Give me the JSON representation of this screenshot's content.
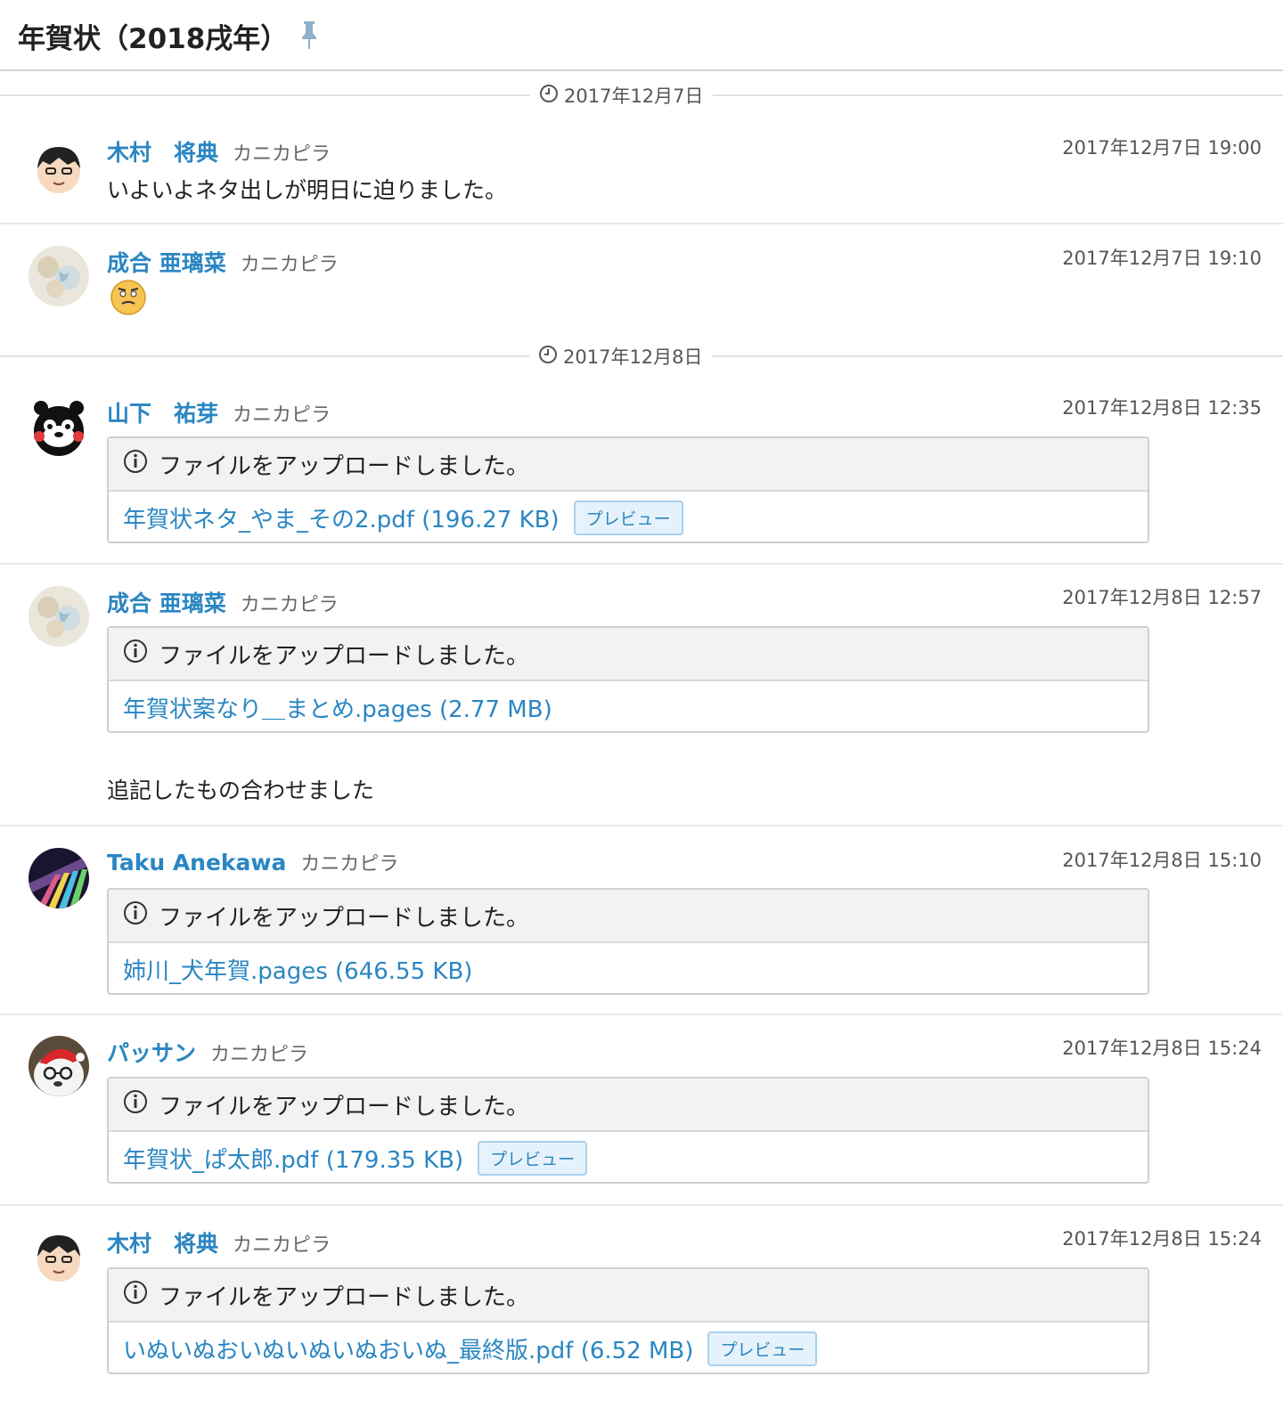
{
  "header": {
    "title": "年賀状（2018戌年）"
  },
  "date_separators": [
    "2017年12月7日",
    "2017年12月8日"
  ],
  "common": {
    "upload_notice": "ファイルをアップロードしました。",
    "preview_label": "プレビュー"
  },
  "messages": [
    {
      "author": "木村　将典",
      "team": "カニカピラ",
      "timestamp": "2017年12月7日 19:00",
      "text": "いよいよネタ出しが明日に迫りました。"
    },
    {
      "author": "成合 亜璃菜",
      "team": "カニカピラ",
      "timestamp": "2017年12月7日 19:10"
    },
    {
      "author": "山下　祐芽",
      "team": "カニカピラ",
      "timestamp": "2017年12月8日 12:35",
      "file": "年賀状ネタ_やま_その2.pdf (196.27 KB)"
    },
    {
      "author": "成合 亜璃菜",
      "team": "カニカピラ",
      "timestamp": "2017年12月8日 12:57",
      "file": "年賀状案なり＿まとめ.pages (2.77 MB)",
      "text": "追記したもの合わせました"
    },
    {
      "author": "Taku Anekawa",
      "team": "カニカピラ",
      "timestamp": "2017年12月8日 15:10",
      "file": "姉川_犬年賀.pages (646.55 KB)"
    },
    {
      "author": "パッサン",
      "team": "カニカピラ",
      "timestamp": "2017年12月8日 15:24",
      "file": "年賀状_ぱ太郎.pdf (179.35 KB)"
    },
    {
      "author": "木村　将典",
      "team": "カニカピラ",
      "timestamp": "2017年12月8日 15:24",
      "file": "いぬいぬおいぬいぬいぬおいぬ_最終版.pdf (6.52 MB)"
    }
  ]
}
